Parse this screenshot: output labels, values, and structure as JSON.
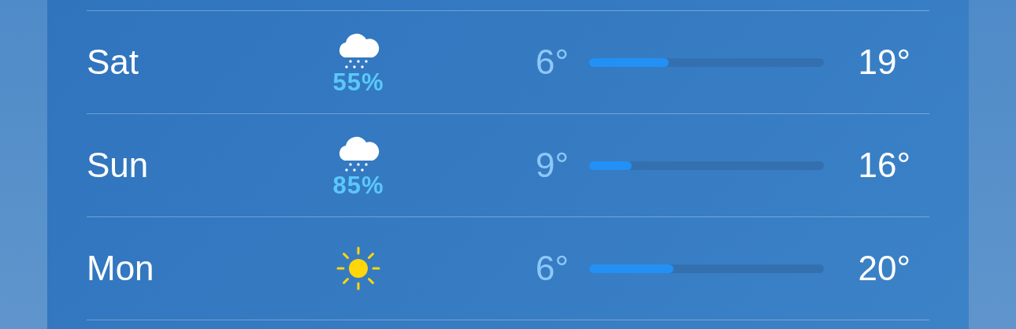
{
  "days": [
    {
      "day": "Sat",
      "kind": "snow",
      "chance": "55%",
      "low": "6°",
      "high": "19°",
      "level": 0.34
    },
    {
      "day": "Sun",
      "kind": "snow",
      "chance": "85%",
      "low": "9°",
      "high": "16°",
      "level": 0.18
    },
    {
      "day": "Mon",
      "kind": "sun",
      "low": "6°",
      "high": "20°",
      "level": 0.36
    }
  ]
}
